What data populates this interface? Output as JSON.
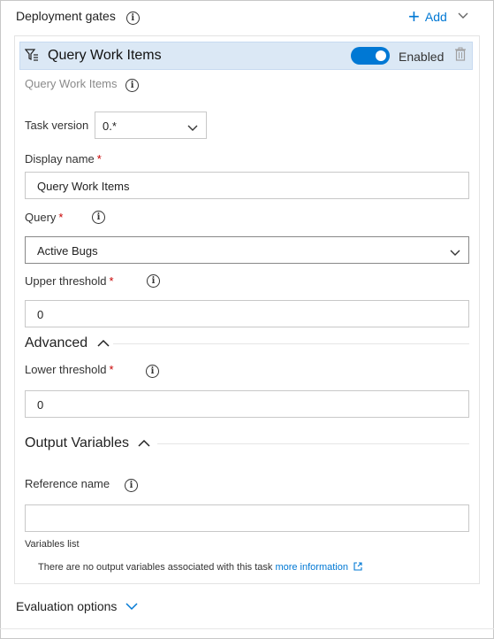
{
  "header": {
    "title": "Deployment gates",
    "add_label": "Add"
  },
  "task": {
    "title": "Query Work Items",
    "toggle_label": "Enabled",
    "subtitle": "Query Work Items",
    "version_label": "Task version",
    "version_value": "0.*",
    "display_name_label": "Display name",
    "display_name_value": "Query Work Items",
    "query_label": "Query",
    "query_value": "Active Bugs",
    "upper_threshold_label": "Upper threshold",
    "upper_threshold_value": "0"
  },
  "advanced": {
    "title": "Advanced",
    "lower_threshold_label": "Lower threshold",
    "lower_threshold_value": "0"
  },
  "output": {
    "title": "Output Variables",
    "reference_name_label": "Reference name",
    "reference_name_value": "",
    "variables_list_label": "Variables list",
    "empty_message": "There are no output variables associated with this task",
    "more_info_link": "more information"
  },
  "evaluation": {
    "title": "Evaluation options"
  },
  "required_marker": "*",
  "colors": {
    "accent": "#0078d4",
    "task_header_bg": "#dbe8f5",
    "required": "#c80000"
  }
}
